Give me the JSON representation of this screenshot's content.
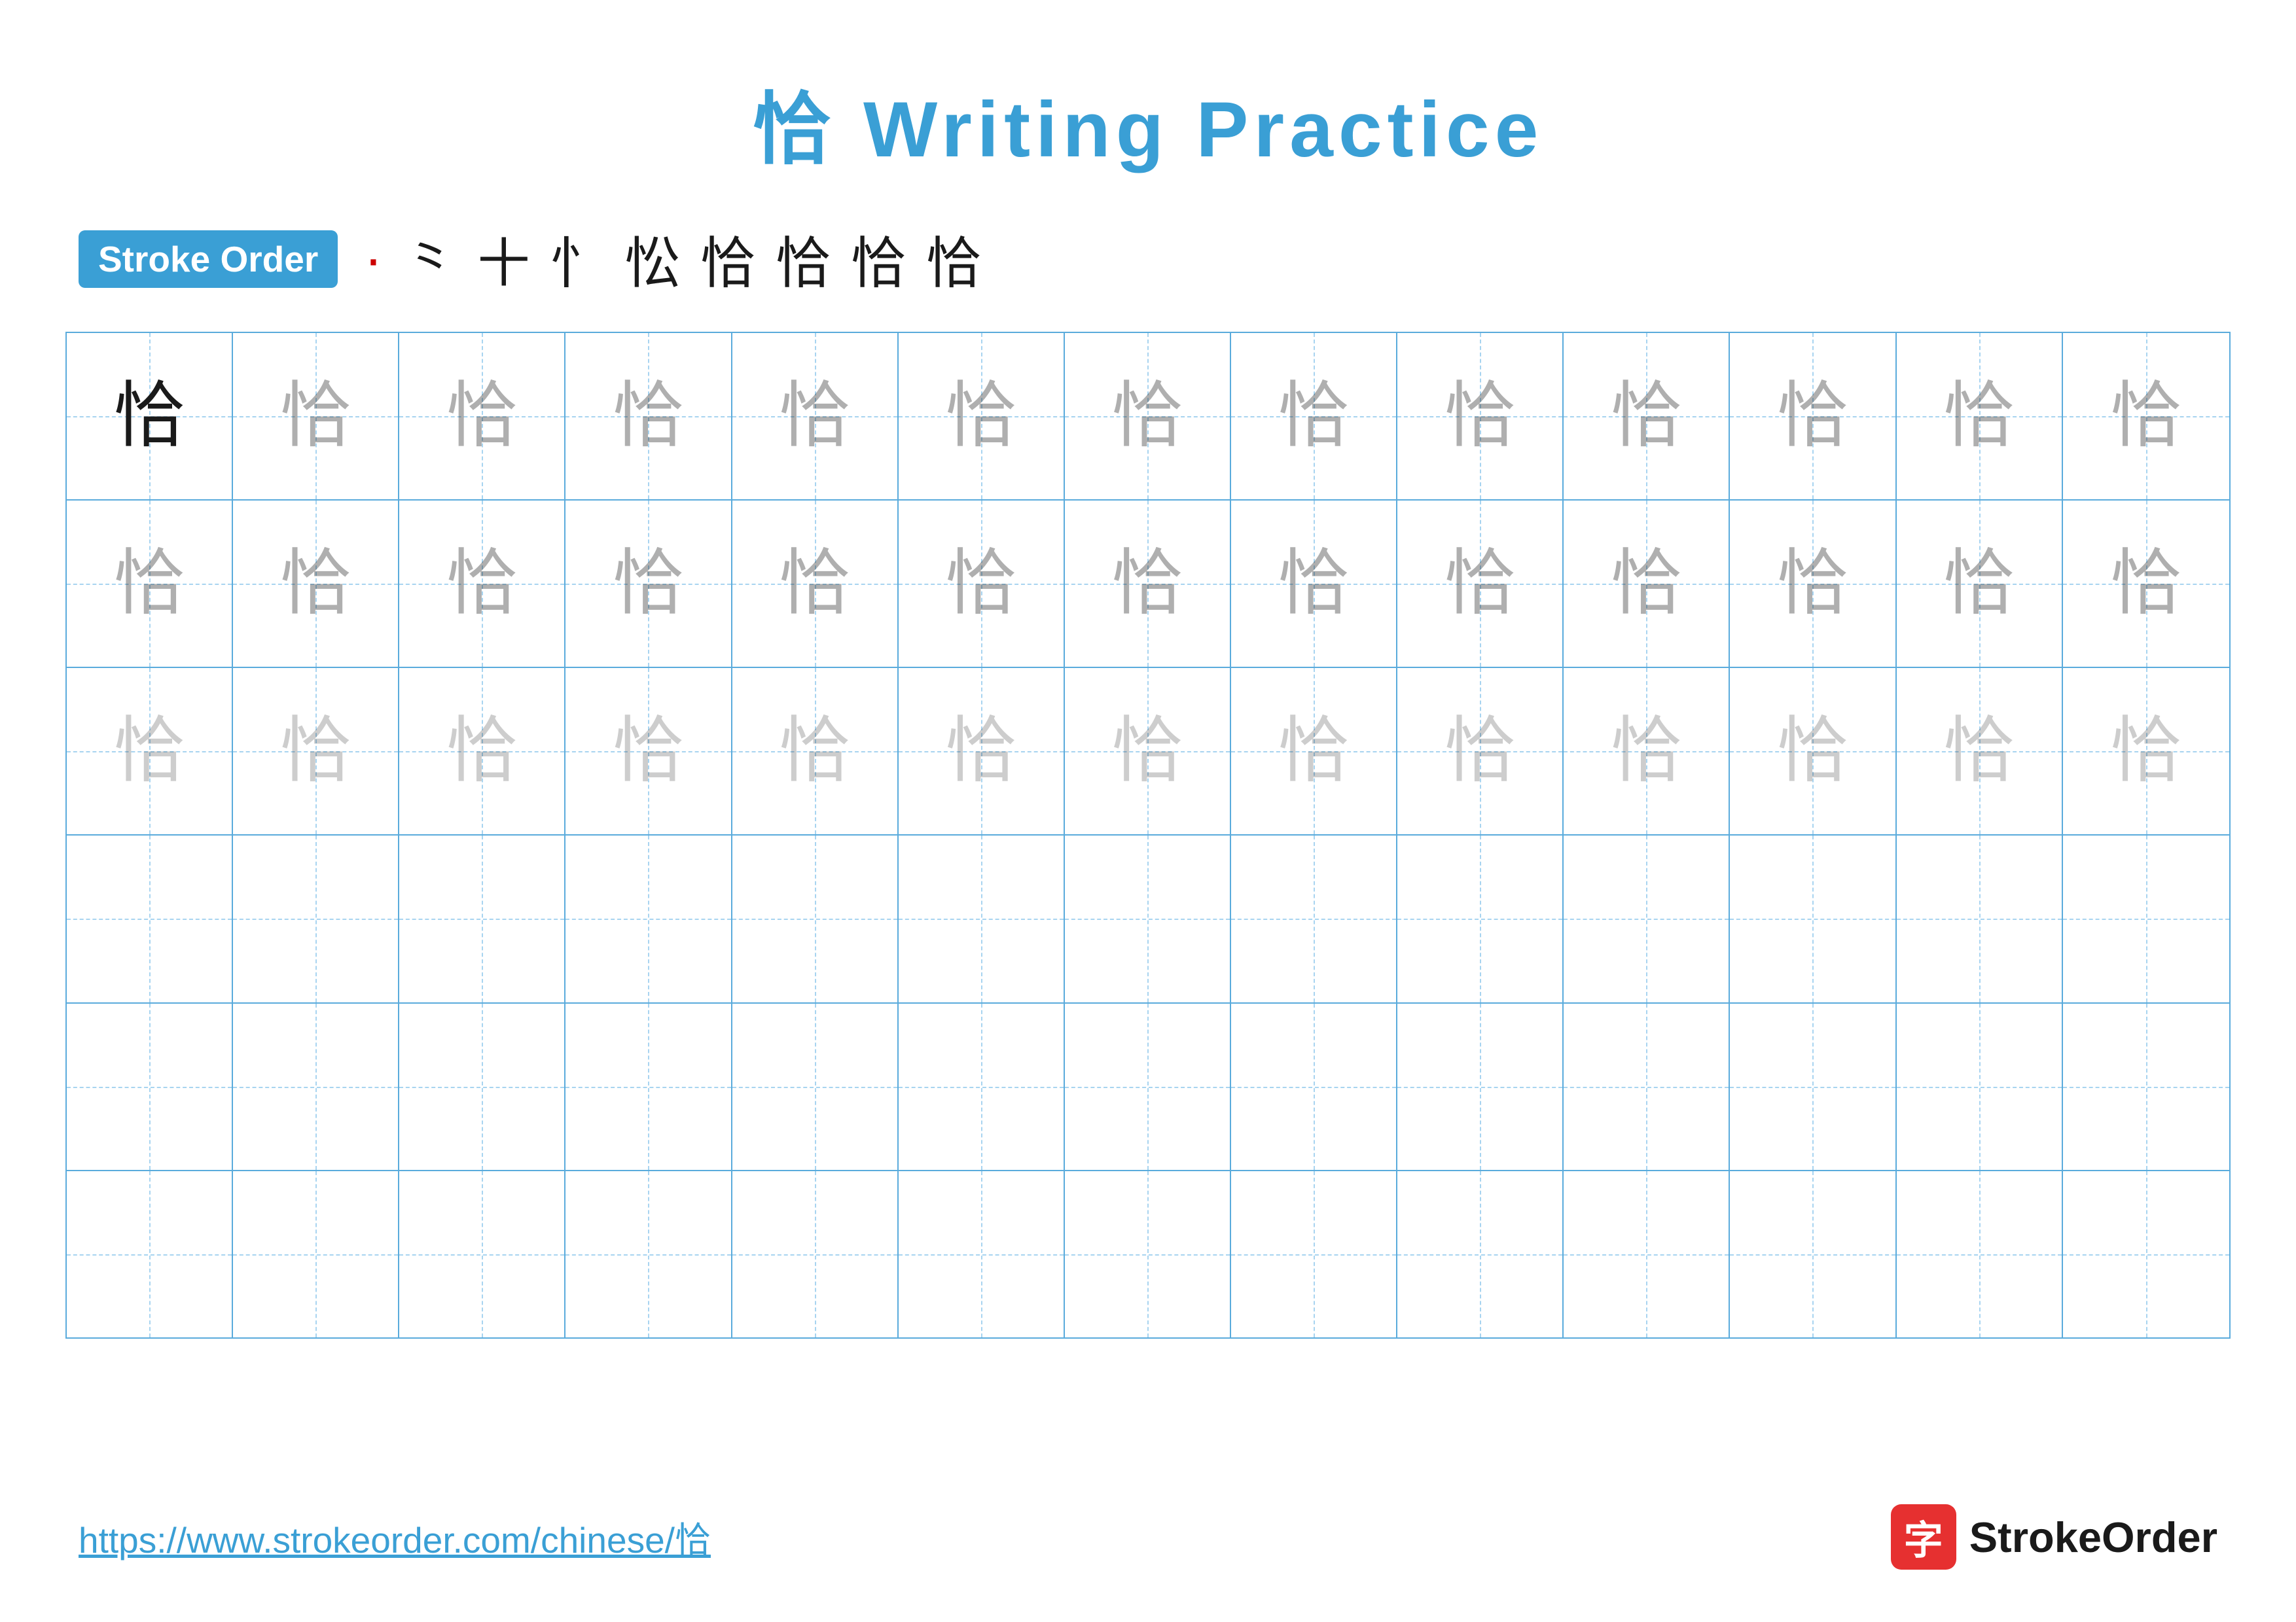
{
  "page": {
    "title": "恰 Writing Practice",
    "title_color": "#3a9fd5"
  },
  "stroke_order": {
    "badge_label": "Stroke Order",
    "strokes": [
      "·",
      "⺀",
      "⼗",
      "忄",
      "忪",
      "恰",
      "恰",
      "恰",
      "恰"
    ]
  },
  "grid": {
    "rows": 6,
    "cols": 13,
    "character": "恰",
    "row_descriptions": [
      "solid_then_light1",
      "light1",
      "light2",
      "empty",
      "empty",
      "empty"
    ]
  },
  "footer": {
    "url": "https://www.strokeorder.com/chinese/恰",
    "logo_icon": "字",
    "logo_text": "StrokeOrder"
  }
}
